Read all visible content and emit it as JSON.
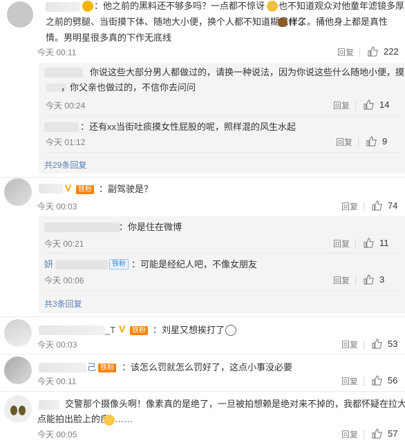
{
  "comments": [
    {
      "text_line1": "：他之前的黑料还不够多吗？一点都不惊讶",
      "text_line1b": "也不知道观众对他童年滤镜多厚，",
      "text_line2": "之前的劈腿、当街摸下体、随地大小便，换个人都不知道糊成什么",
      "text_line2b": "样了。捅他身上都是真性",
      "text_line3": "情。男明星很多真的下作无底线",
      "time": "今天 00:11",
      "reply": "回复",
      "likes": "222",
      "replies": [
        {
          "text_line1": "你说这些大部分男人都做过的，请换一种说法，因为你说这些什么随地小便，摸下",
          "text_line2": "，你父亲也做过的，不信你去问问",
          "time": "今天 00:24",
          "reply": "回复",
          "likes": "14"
        },
        {
          "text": "：还有xx当街吐痰摸女性屁股的呢，照样混的风生水起",
          "time": "今天 01:12",
          "reply": "回复",
          "likes": "9"
        }
      ],
      "more": "共29条回复"
    },
    {
      "badge": "铁粉",
      "text": "：副驾驶是？",
      "time": "今天 00:03",
      "reply": "回复",
      "likes": "74",
      "replies": [
        {
          "text": "：你是住在微博",
          "time": "今天 00:21",
          "reply": "回复",
          "likes": "11"
        },
        {
          "name_prefix": "妍",
          "badge": "铁粉",
          "text": "：可能是经纪人吧，不像女朋友",
          "time": "今天 00:06",
          "reply": "回复",
          "likes": "3"
        }
      ],
      "more": "共3条回复"
    },
    {
      "name_suffix": "_T",
      "badge": "铁粉",
      "text": "：刘星又想挨打了",
      "time": "今天 00:03",
      "reply": "回复",
      "likes": "53"
    },
    {
      "name_suffix": "己",
      "badge": "铁粉",
      "text": "：该怎么罚就怎么罚好了，这点小事没必要",
      "time": "今天 00:11",
      "reply": "回复",
      "likes": "56"
    },
    {
      "text_line1": "交警那个摄像头啊！像素真的是绝了，一旦被拍想赖是绝对来不掉的，我都怀疑在拉大",
      "text_line2": "点能拍出脸上的痘",
      "text_line2b": "……",
      "time": "今天 00:05",
      "reply": "回复",
      "likes": "57"
    }
  ]
}
